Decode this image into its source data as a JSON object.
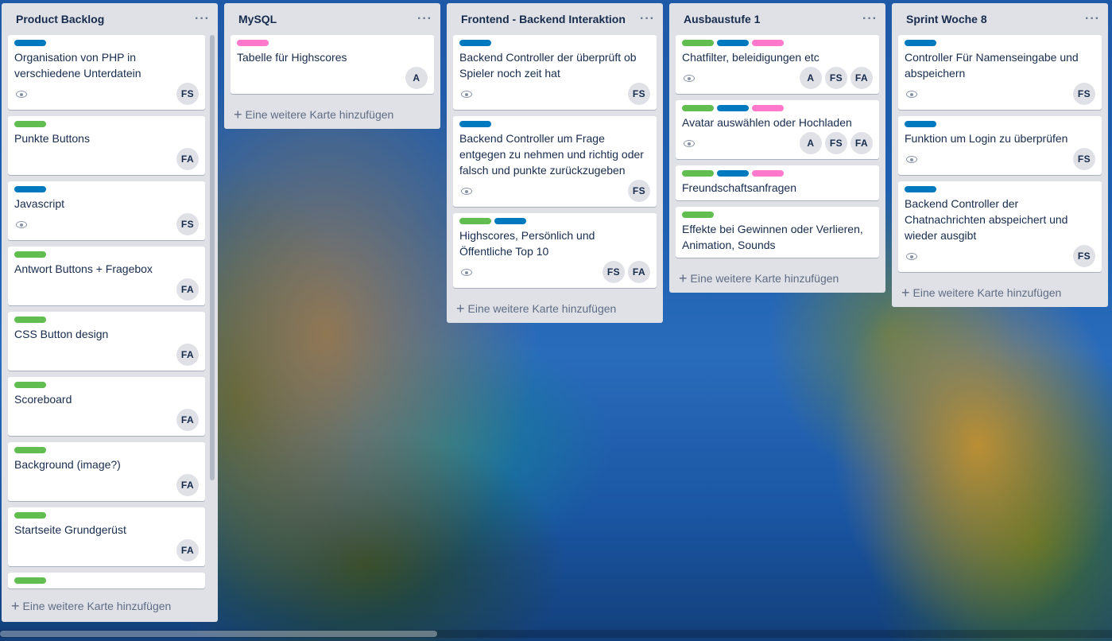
{
  "board": {
    "add_card_label": "Eine weitere Karte hinzufügen",
    "label_colors": {
      "green": "#61bd4f",
      "blue": "#0079bf",
      "pink": "#ff78cb"
    },
    "lists": [
      {
        "title": "Product Backlog",
        "cards": [
          {
            "labels": [
              "blue"
            ],
            "title": "Organisation von PHP in verschiedene Unterdatein",
            "watch": true,
            "members": [
              "FS"
            ]
          },
          {
            "labels": [
              "green"
            ],
            "title": "Punkte Buttons",
            "watch": false,
            "members": [
              "FA"
            ]
          },
          {
            "labels": [
              "blue"
            ],
            "title": "Javascript",
            "watch": true,
            "members": [
              "FS"
            ]
          },
          {
            "labels": [
              "green"
            ],
            "title": "Antwort Buttons + Fragebox",
            "watch": false,
            "members": [
              "FA"
            ]
          },
          {
            "labels": [
              "green"
            ],
            "title": "CSS Button design",
            "watch": false,
            "members": [
              "FA"
            ]
          },
          {
            "labels": [
              "green"
            ],
            "title": "Scoreboard",
            "watch": false,
            "members": [
              "FA"
            ]
          },
          {
            "labels": [
              "green"
            ],
            "title": "Background (image?)",
            "watch": false,
            "members": [
              "FA"
            ]
          },
          {
            "labels": [
              "green"
            ],
            "title": "Startseite Grundgerüst",
            "watch": false,
            "members": [
              "FA"
            ]
          }
        ]
      },
      {
        "title": "MySQL",
        "cards": [
          {
            "labels": [
              "pink"
            ],
            "title": "Tabelle für Highscores",
            "watch": false,
            "members": [
              "A"
            ]
          }
        ]
      },
      {
        "title": "Frontend - Backend Interaktion",
        "cards": [
          {
            "labels": [
              "blue"
            ],
            "title": "Backend Controller der überprüft ob Spieler noch zeit hat",
            "watch": true,
            "members": [
              "FS"
            ]
          },
          {
            "labels": [
              "blue"
            ],
            "title": "Backend Controller um Frage entgegen zu nehmen und richtig oder falsch und punkte zurückzugeben",
            "watch": true,
            "members": [
              "FS"
            ]
          },
          {
            "labels": [
              "green",
              "blue"
            ],
            "title": "Highscores, Persönlich und Öffentliche Top 10",
            "watch": true,
            "members": [
              "FS",
              "FA"
            ]
          }
        ]
      },
      {
        "title": "Ausbaustufe 1",
        "cards": [
          {
            "labels": [
              "green",
              "blue",
              "pink"
            ],
            "title": "Chatfilter, beleidigungen etc",
            "watch": true,
            "members": [
              "A",
              "FS",
              "FA"
            ]
          },
          {
            "labels": [
              "green",
              "blue",
              "pink"
            ],
            "title": "Avatar auswählen oder Hochladen",
            "watch": true,
            "members": [
              "A",
              "FS",
              "FA"
            ]
          },
          {
            "labels": [
              "green",
              "blue",
              "pink"
            ],
            "title": "Freundschaftsanfragen",
            "watch": false,
            "members": []
          },
          {
            "labels": [
              "green"
            ],
            "title": "Effekte bei Gewinnen oder Verlieren, Animation, Sounds",
            "watch": false,
            "members": []
          }
        ]
      },
      {
        "title": "Sprint Woche 8",
        "cards": [
          {
            "labels": [
              "blue"
            ],
            "title": "Controller Für Namenseingabe und abspeichern",
            "watch": true,
            "members": [
              "FS"
            ]
          },
          {
            "labels": [
              "blue"
            ],
            "title": "Funktion um Login zu überprüfen",
            "watch": true,
            "members": [
              "FS"
            ]
          },
          {
            "labels": [
              "blue"
            ],
            "title": "Backend Controller der Chatnachrichten abspeichert und wieder ausgibt",
            "watch": true,
            "members": [
              "FS"
            ]
          }
        ]
      }
    ]
  }
}
